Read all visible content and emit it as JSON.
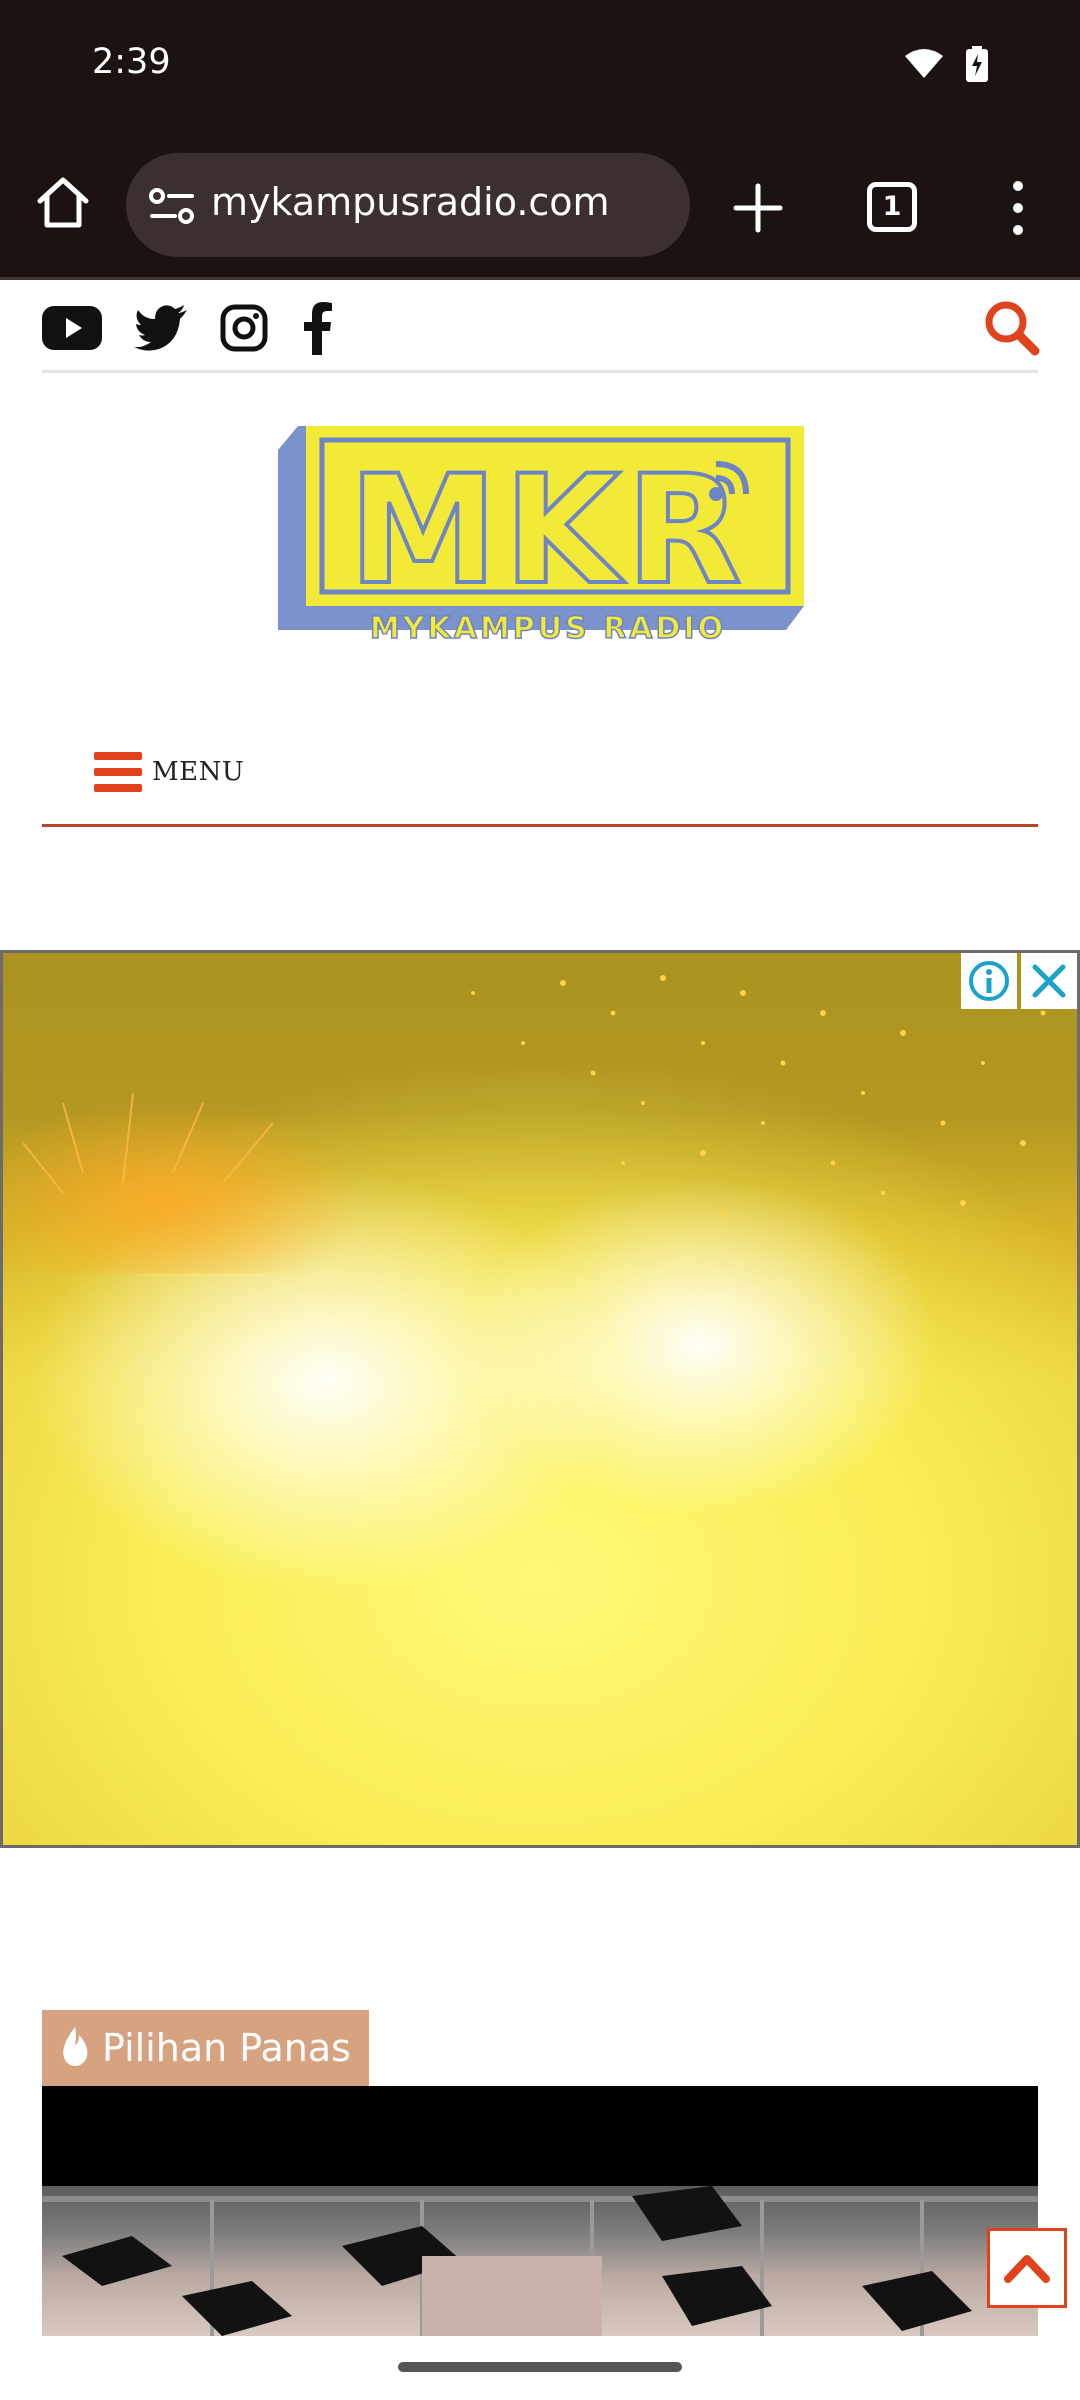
{
  "status_bar": {
    "time": "2:39",
    "icons": [
      "wifi-icon",
      "battery-charging-icon"
    ]
  },
  "browser": {
    "url": "mykampusradio.com",
    "tab_count": "1",
    "icons": [
      "home-icon",
      "site-settings-icon",
      "new-tab-icon",
      "tabs-icon",
      "more-icon"
    ]
  },
  "site": {
    "social": [
      "youtube-icon",
      "twitter-icon",
      "instagram-icon",
      "facebook-icon"
    ],
    "logo": {
      "letters": "MKR",
      "tagline": "MYKAMPUS RADIO"
    },
    "menu_label": "MENU",
    "accent_color": "#e0421b"
  },
  "ad": {
    "info_icon": "info-icon",
    "close_icon": "close-icon"
  },
  "section": {
    "tag_label": "Pilihan Panas",
    "tag_icon": "fire-icon",
    "tag_color": "#d6a27f"
  }
}
